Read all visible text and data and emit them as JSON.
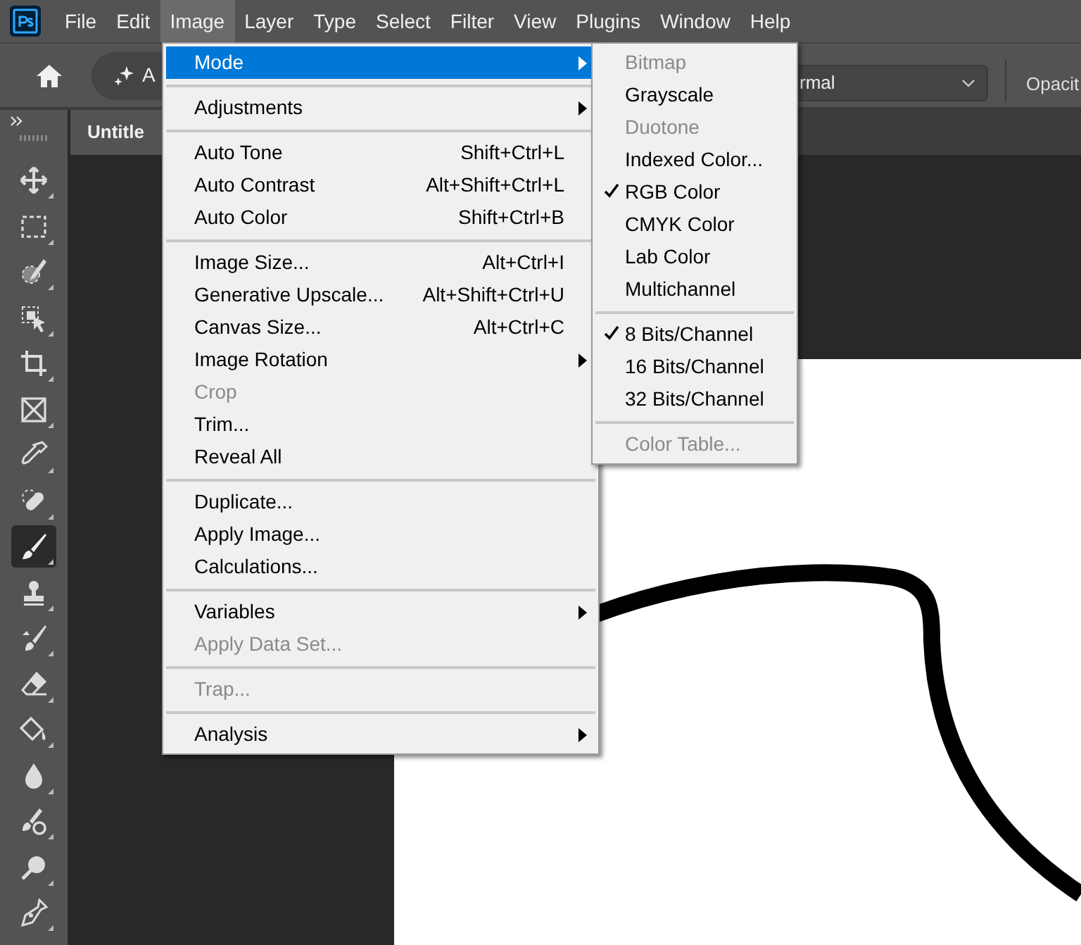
{
  "menu_bar": [
    {
      "label": "File",
      "selected": false
    },
    {
      "label": "Edit",
      "selected": false
    },
    {
      "label": "Image",
      "selected": true
    },
    {
      "label": "Layer",
      "selected": false
    },
    {
      "label": "Type",
      "selected": false
    },
    {
      "label": "Select",
      "selected": false
    },
    {
      "label": "Filter",
      "selected": false
    },
    {
      "label": "View",
      "selected": false
    },
    {
      "label": "Plugins",
      "selected": false
    },
    {
      "label": "Window",
      "selected": false
    },
    {
      "label": "Help",
      "selected": false
    }
  ],
  "options_bar": {
    "preset_label": "A",
    "blend_mode": "rmal",
    "opacity_label": "Opacit"
  },
  "document_tab": {
    "title": "Untitle"
  },
  "tools": [
    {
      "kind": "move",
      "selected": false
    },
    {
      "kind": "marquee",
      "selected": false
    },
    {
      "kind": "quick-select",
      "selected": false
    },
    {
      "kind": "object-select",
      "selected": false
    },
    {
      "kind": "crop",
      "selected": false
    },
    {
      "kind": "frame",
      "selected": false
    },
    {
      "kind": "eyedropper",
      "selected": false
    },
    {
      "kind": "healing",
      "selected": false
    },
    {
      "kind": "brush",
      "selected": true
    },
    {
      "kind": "stamp",
      "selected": false
    },
    {
      "kind": "history-brush",
      "selected": false
    },
    {
      "kind": "eraser",
      "selected": false
    },
    {
      "kind": "bucket",
      "selected": false
    },
    {
      "kind": "blur",
      "selected": false
    },
    {
      "kind": "dodge-brush",
      "selected": false
    },
    {
      "kind": "dodge",
      "selected": false
    },
    {
      "kind": "pen",
      "selected": false
    }
  ],
  "image_menu": [
    {
      "kind": "item",
      "label": "Mode",
      "submenu": true,
      "disabled": false,
      "selected": true
    },
    {
      "kind": "separator"
    },
    {
      "kind": "item",
      "label": "Adjustments",
      "submenu": true,
      "disabled": false,
      "selected": false
    },
    {
      "kind": "separator"
    },
    {
      "kind": "item",
      "label": "Auto Tone",
      "shortcut": "Shift+Ctrl+L",
      "submenu": false,
      "disabled": false,
      "selected": false
    },
    {
      "kind": "item",
      "label": "Auto Contrast",
      "shortcut": "Alt+Shift+Ctrl+L",
      "submenu": false,
      "disabled": false,
      "selected": false
    },
    {
      "kind": "item",
      "label": "Auto Color",
      "shortcut": "Shift+Ctrl+B",
      "submenu": false,
      "disabled": false,
      "selected": false
    },
    {
      "kind": "separator"
    },
    {
      "kind": "item",
      "label": "Image Size...",
      "shortcut": "Alt+Ctrl+I",
      "submenu": false,
      "disabled": false,
      "selected": false
    },
    {
      "kind": "item",
      "label": "Generative Upscale...",
      "shortcut": "Alt+Shift+Ctrl+U",
      "submenu": false,
      "disabled": false,
      "selected": false
    },
    {
      "kind": "item",
      "label": "Canvas Size...",
      "shortcut": "Alt+Ctrl+C",
      "submenu": false,
      "disabled": false,
      "selected": false
    },
    {
      "kind": "item",
      "label": "Image Rotation",
      "submenu": true,
      "disabled": false,
      "selected": false
    },
    {
      "kind": "item",
      "label": "Crop",
      "submenu": false,
      "disabled": true,
      "selected": false
    },
    {
      "kind": "item",
      "label": "Trim...",
      "submenu": false,
      "disabled": false,
      "selected": false
    },
    {
      "kind": "item",
      "label": "Reveal All",
      "submenu": false,
      "disabled": false,
      "selected": false
    },
    {
      "kind": "separator"
    },
    {
      "kind": "item",
      "label": "Duplicate...",
      "submenu": false,
      "disabled": false,
      "selected": false
    },
    {
      "kind": "item",
      "label": "Apply Image...",
      "submenu": false,
      "disabled": false,
      "selected": false
    },
    {
      "kind": "item",
      "label": "Calculations...",
      "submenu": false,
      "disabled": false,
      "selected": false
    },
    {
      "kind": "separator"
    },
    {
      "kind": "item",
      "label": "Variables",
      "submenu": true,
      "disabled": false,
      "selected": false
    },
    {
      "kind": "item",
      "label": "Apply Data Set...",
      "submenu": false,
      "disabled": true,
      "selected": false
    },
    {
      "kind": "separator"
    },
    {
      "kind": "item",
      "label": "Trap...",
      "submenu": false,
      "disabled": true,
      "selected": false
    },
    {
      "kind": "separator"
    },
    {
      "kind": "item",
      "label": "Analysis",
      "submenu": true,
      "disabled": false,
      "selected": false
    }
  ],
  "mode_submenu": [
    {
      "kind": "item",
      "label": "Bitmap",
      "checked": false,
      "disabled": true
    },
    {
      "kind": "item",
      "label": "Grayscale",
      "checked": false,
      "disabled": false
    },
    {
      "kind": "item",
      "label": "Duotone",
      "checked": false,
      "disabled": true
    },
    {
      "kind": "item",
      "label": "Indexed Color...",
      "checked": false,
      "disabled": false
    },
    {
      "kind": "item",
      "label": "RGB Color",
      "checked": true,
      "disabled": false
    },
    {
      "kind": "item",
      "label": "CMYK Color",
      "checked": false,
      "disabled": false
    },
    {
      "kind": "item",
      "label": "Lab Color",
      "checked": false,
      "disabled": false
    },
    {
      "kind": "item",
      "label": "Multichannel",
      "checked": false,
      "disabled": false
    },
    {
      "kind": "separator"
    },
    {
      "kind": "item",
      "label": "8 Bits/Channel",
      "checked": true,
      "disabled": false
    },
    {
      "kind": "item",
      "label": "16 Bits/Channel",
      "checked": false,
      "disabled": false
    },
    {
      "kind": "item",
      "label": "32 Bits/Channel",
      "checked": false,
      "disabled": false
    },
    {
      "kind": "separator"
    },
    {
      "kind": "item",
      "label": "Color Table...",
      "checked": false,
      "disabled": true
    }
  ]
}
